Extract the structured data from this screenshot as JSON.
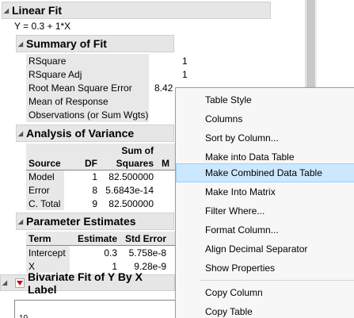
{
  "linear_fit": {
    "title": "Linear Fit",
    "equation": "Y = 0.3 + 1*X"
  },
  "summary_of_fit": {
    "title": "Summary of Fit",
    "rows": [
      {
        "label": "RSquare",
        "value": "1"
      },
      {
        "label": "RSquare Adj",
        "value": "1"
      },
      {
        "label": "Root Mean Square Error",
        "value": "8.42"
      },
      {
        "label": "Mean of Response",
        "value": ""
      },
      {
        "label": "Observations (or Sum Wgts)",
        "value": ""
      }
    ]
  },
  "analysis_of_variance": {
    "title": "Analysis of Variance",
    "headers": {
      "source": "Source",
      "df": "DF",
      "ss_top": "Sum of",
      "ss_bottom": "Squares",
      "ms": "M"
    },
    "rows": [
      {
        "source": "Model",
        "df": "1",
        "ss": "82.500000"
      },
      {
        "source": "Error",
        "df": "8",
        "ss": "5.6843e-14"
      },
      {
        "source": "C. Total",
        "df": "9",
        "ss": "82.500000"
      }
    ]
  },
  "parameter_estimates": {
    "title": "Parameter Estimates",
    "headers": {
      "term": "Term",
      "estimate": "Estimate",
      "std_error": "Std Error"
    },
    "rows": [
      {
        "term": "Intercept",
        "estimate": "0.3",
        "std_error": "5.758e-8"
      },
      {
        "term": "X",
        "estimate": "1",
        "std_error": "9.28e-9"
      }
    ]
  },
  "bivariate": {
    "title": "Bivariate Fit of Y By X Label",
    "axis_tick": "10"
  },
  "context_menu": {
    "items": [
      "Table Style",
      "Columns",
      "Sort by Column...",
      "Make into Data Table",
      "Make Combined Data Table",
      "Make Into Matrix",
      "Filter Where...",
      "Format Column...",
      "Align Decimal Separator",
      "Show Properties",
      "Copy Column",
      "Copy Table"
    ],
    "highlighted": "Make Combined Data Table"
  }
}
